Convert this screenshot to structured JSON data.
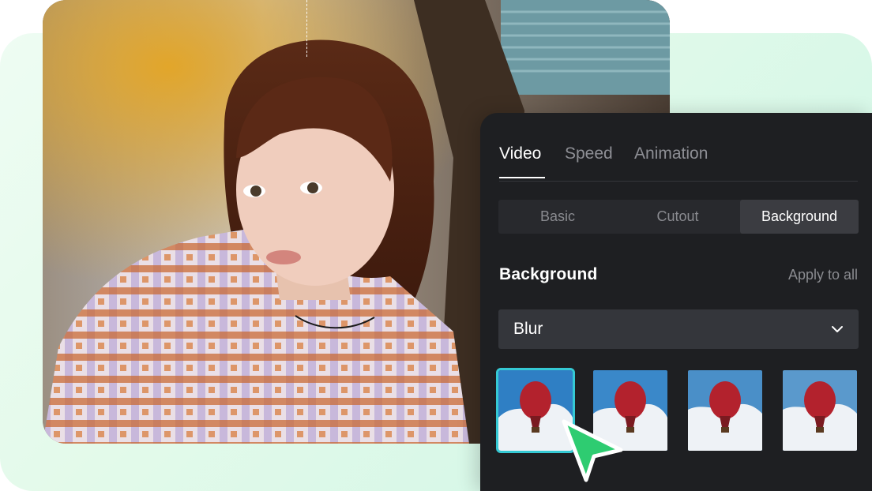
{
  "tabs": [
    {
      "label": "Video",
      "active": true
    },
    {
      "label": "Speed",
      "active": false
    },
    {
      "label": "Animation",
      "active": false
    }
  ],
  "segments": [
    {
      "label": "Basic",
      "active": false
    },
    {
      "label": "Cutout",
      "active": false
    },
    {
      "label": "Background",
      "active": true
    }
  ],
  "section": {
    "title": "Background",
    "apply_all": "Apply to all"
  },
  "dropdown": {
    "value": "Blur"
  },
  "thumbnails": {
    "count": 4,
    "selected_index": 0,
    "selected_color": "#35c9d4"
  },
  "colors": {
    "panel_bg": "#1e1f22",
    "cursor": "#2ecc71",
    "backdrop": "#e3faea"
  },
  "icons": {
    "dropdown": "chevron-down-icon",
    "pointer": "cursor-arrow-icon"
  }
}
